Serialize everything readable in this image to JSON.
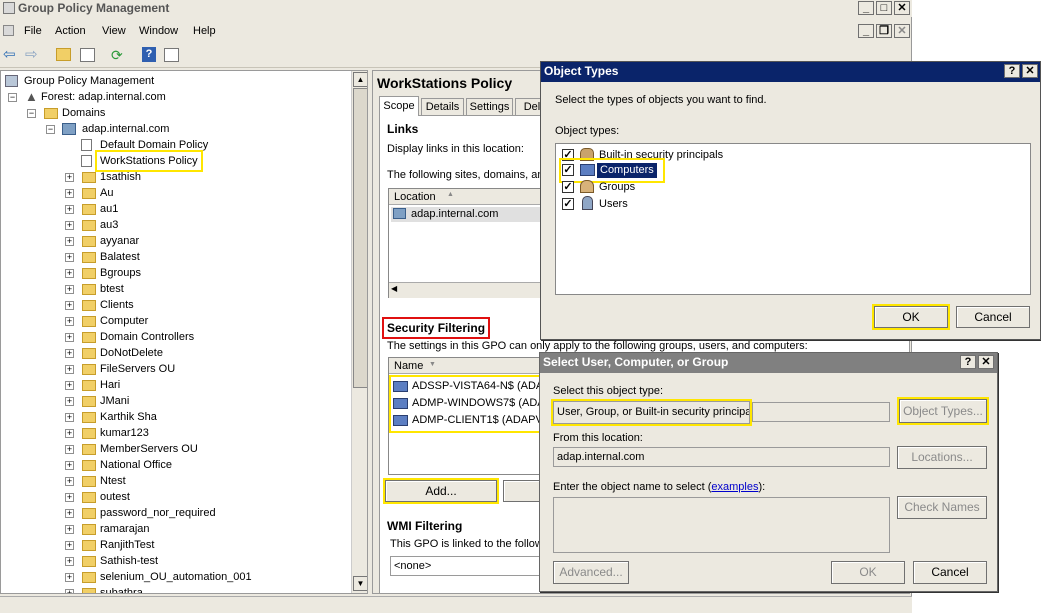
{
  "window": {
    "title": "Group Policy Management"
  },
  "menu": [
    "File",
    "Action",
    "View",
    "Window",
    "Help"
  ],
  "tree": {
    "root": "Group Policy Management",
    "forest": "Forest: adap.internal.com",
    "domains": "Domains",
    "domain": "adap.internal.com",
    "gpos": [
      "Default Domain Policy",
      "WorkStations Policy"
    ],
    "ous": [
      "1sathish",
      "Au",
      "au1",
      "au3",
      "ayyanar",
      "Balatest",
      "Bgroups",
      "btest",
      "Clients",
      "Computer",
      "Domain Controllers",
      "DoNotDelete",
      "FileServers OU",
      "Hari",
      "JMani",
      "Karthik Sha",
      "kumar123",
      "MemberServers OU",
      "National Office",
      "Ntest",
      "outest",
      "password_nor_required",
      "ramarajan",
      "RanjithTest",
      "Sathish-test",
      "selenium_OU_automation_001",
      "subathra"
    ]
  },
  "policy": {
    "title": "WorkStations Policy",
    "tabs": [
      "Scope",
      "Details",
      "Settings",
      "Dele"
    ],
    "links_heading": "Links",
    "links_display": "Display links in this location:",
    "links_following": "The following sites, domains, and",
    "links_col": "Location",
    "links_rows": [
      "adap.internal.com"
    ],
    "security_heading": "Security Filtering",
    "security_text": "The settings in this GPO can only apply to the following groups, users, and computers:",
    "security_col": "Name",
    "security_rows": [
      "ADSSP-VISTA64-N$ (ADA",
      "ADMP-WINDOWS7$ (ADA",
      "ADMP-CLIENT1$ (ADAPV"
    ],
    "add_button": "Add...",
    "wmi_heading": "WMI Filtering",
    "wmi_text": "This GPO is linked to the followi",
    "wmi_value": "<none>"
  },
  "object_types": {
    "title": "Object Types",
    "instruction": "Select the types of objects you want to find.",
    "list_label": "Object types:",
    "items": [
      {
        "label": "Built-in security principals",
        "checked": true
      },
      {
        "label": "Computers",
        "checked": true
      },
      {
        "label": "Groups",
        "checked": true
      },
      {
        "label": "Users",
        "checked": true
      }
    ],
    "ok": "OK",
    "cancel": "Cancel"
  },
  "select_dialog": {
    "title": "Select User, Computer, or Group",
    "type_label": "Select this object type:",
    "type_value": "User, Group, or Built-in security principal",
    "object_types_button": "Object Types...",
    "location_label": "From this location:",
    "location_value": "adap.internal.com",
    "locations_button": "Locations...",
    "enter_label_pre": "Enter the object name to select (",
    "enter_link": "examples",
    "enter_label_post": "):",
    "check_names": "Check Names",
    "advanced": "Advanced...",
    "ok": "OK",
    "cancel": "Cancel"
  },
  "colors": {
    "titlebar_active": "#0a246a",
    "titlebar_inactive": "#808080",
    "highlight": "#ffe600",
    "selection": "#0a246a"
  }
}
